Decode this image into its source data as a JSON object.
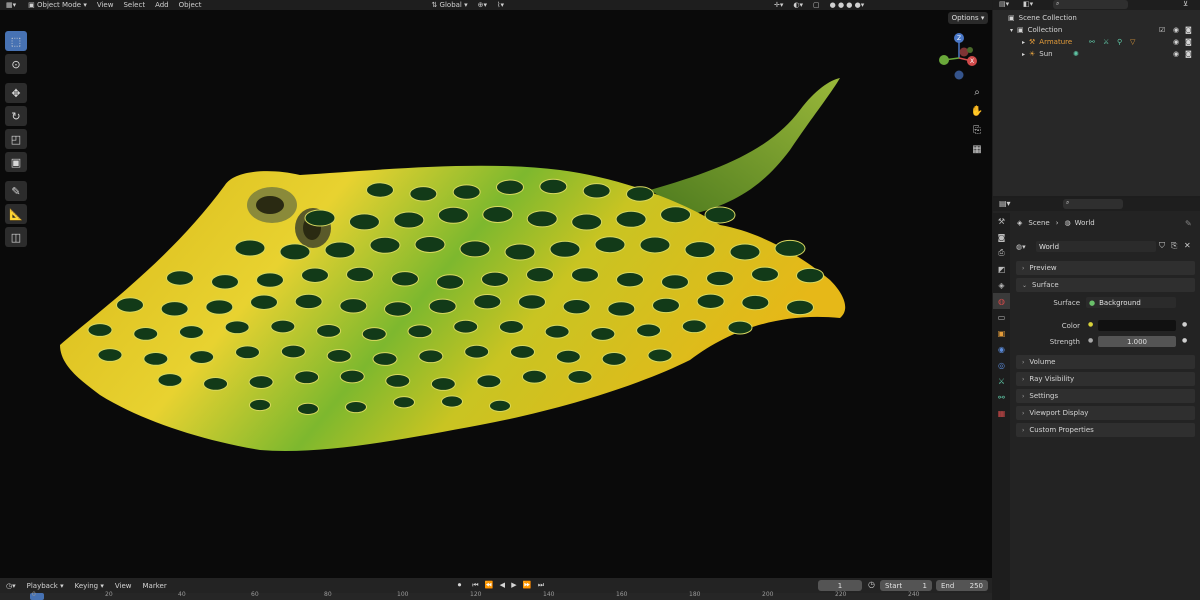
{
  "viewport": {
    "menu": {
      "mode": "Object Mode",
      "view": "View",
      "select": "Select",
      "add": "Add",
      "object": "Object"
    },
    "transform_orientation": "Global",
    "options_label": "Options",
    "tools": [
      "select-box",
      "cursor",
      "move",
      "rotate",
      "scale",
      "transform",
      "annotate",
      "measure",
      "add-cube"
    ],
    "gizmo": {
      "z": "Z",
      "x": "X",
      "y": "Y"
    },
    "model": {
      "body_color": "#e8c81c",
      "back_color": "#5a9a2c",
      "spot_color": "#123a18"
    }
  },
  "outliner": {
    "scene_collection": "Scene Collection",
    "collection": "Collection",
    "items": [
      {
        "label": "Armature",
        "color": "#e29b3a"
      },
      {
        "label": "Sun",
        "color": "#d8d8d8"
      }
    ]
  },
  "properties": {
    "breadcrumb": {
      "scene": "Scene",
      "world": "World"
    },
    "world_name": "World",
    "panels": {
      "preview": "Preview",
      "surface": "Surface",
      "volume": "Volume",
      "ray_visibility": "Ray Visibility",
      "settings": "Settings",
      "viewport_display": "Viewport Display",
      "custom_properties": "Custom Properties"
    },
    "surface_label": "Surface",
    "surface_value": "Background",
    "color_label": "Color",
    "color_value": "#111111",
    "strength_label": "Strength",
    "strength_value": "1.000"
  },
  "timeline": {
    "menus": {
      "playback": "Playback",
      "keying": "Keying",
      "view": "View",
      "marker": "Marker"
    },
    "current_frame": "1",
    "start_label": "Start",
    "start_value": "1",
    "end_label": "End",
    "end_value": "250",
    "ruler": [
      "0",
      "20",
      "40",
      "60",
      "80",
      "100",
      "120",
      "140",
      "160",
      "180",
      "200",
      "220",
      "240"
    ]
  },
  "colors": {
    "accent": "#4772b3",
    "bg_dark": "#0a0a0a",
    "panel": "#2f2f2f"
  }
}
